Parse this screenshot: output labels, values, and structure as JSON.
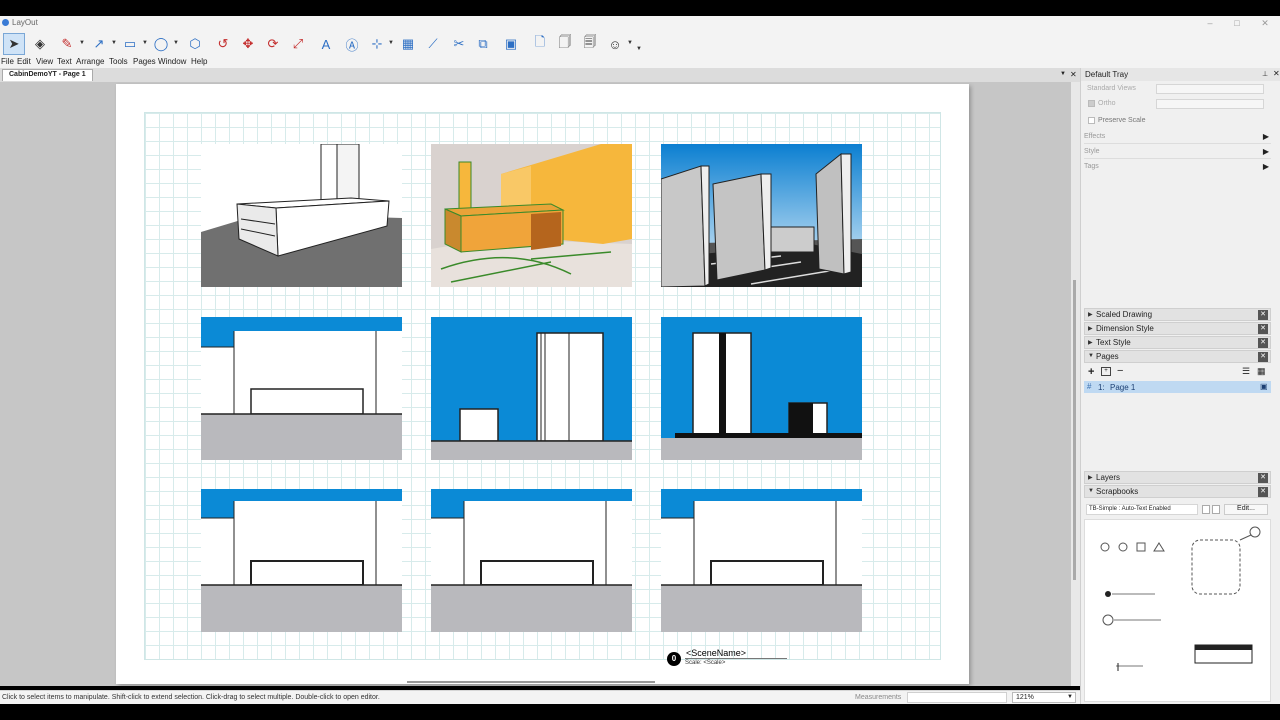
{
  "window": {
    "title": "LayOut"
  },
  "menu": [
    "File",
    "Edit",
    "View",
    "Text",
    "Arrange",
    "Tools",
    "Pages",
    "Window",
    "Help"
  ],
  "toolbar": {
    "tools": [
      "select-tool-icon",
      "eraser-icon",
      "pencil-icon",
      "line-icon",
      "rectangle-icon",
      "circle-icon",
      "polygon-icon",
      "offset-icon",
      "move-icon",
      "rotate-icon",
      "scale-icon",
      "text-icon",
      "label-icon",
      "dimension-icon",
      "table-icon",
      "style-dropper-icon",
      "split-icon",
      "join-icon",
      "presentation-icon",
      "new-page-icon",
      "duplicate-page-icon",
      "delete-page-icon",
      "account-icon"
    ]
  },
  "document": {
    "tab": "CabinDemoYT - Page 1",
    "scene_label": {
      "marker": "0",
      "name": "<SceneName>",
      "scale": "Scale: <Scale>"
    }
  },
  "status": {
    "hint": "Click to select items to manipulate. Shift-click to extend selection. Click-drag to select multiple. Double-click to open editor.",
    "measurements_label": "Measurements",
    "zoom": "121%"
  },
  "tray": {
    "title": "Default Tray",
    "standard_views": "Standard Views",
    "ortho": "Ortho",
    "preserve_scale": "Preserve Scale",
    "effects": "Effects",
    "style": "Style",
    "tags": "Tags",
    "panels": {
      "scaled_drawing": "Scaled Drawing",
      "dimension_style": "Dimension Style",
      "text_style": "Text Style",
      "pages": "Pages",
      "layers": "Layers",
      "scrapbooks": "Scrapbooks"
    },
    "pages_list": [
      {
        "number": "1:",
        "name": "Page 1"
      }
    ],
    "scrapbook_select": "TB-Simple : Auto-Text Enabled",
    "scrapbook_edit": "Edit..."
  },
  "colors": {
    "sky_blue": "#0b8ad6",
    "orange": "#f6b73c",
    "ground_gray": "#b9b9bd",
    "selection": "#bfd9f2"
  }
}
